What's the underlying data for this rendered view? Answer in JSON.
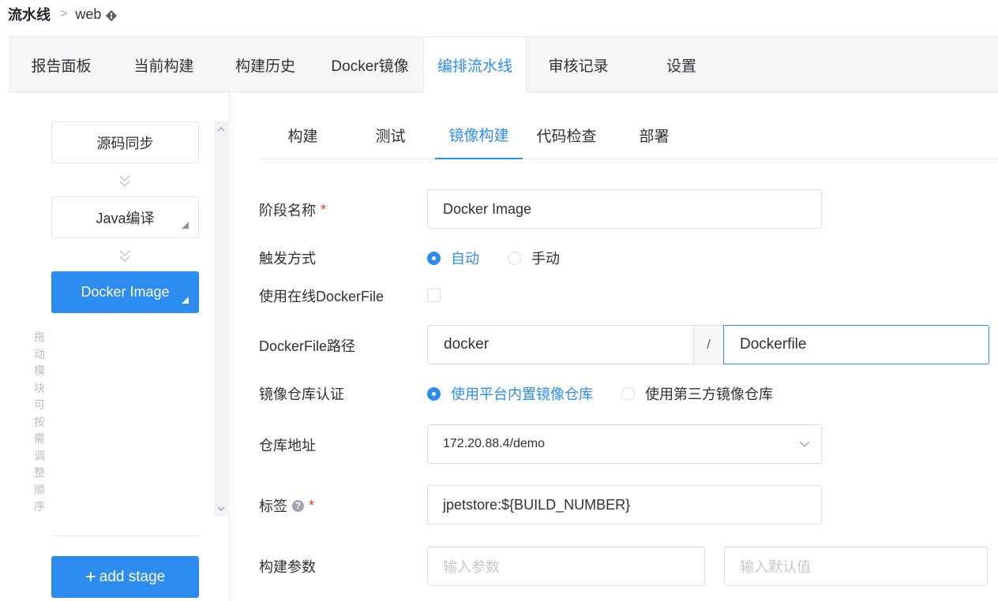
{
  "breadcrumb": {
    "root": "流水线",
    "separator": ">",
    "current": "web"
  },
  "top_tabs": [
    {
      "label": "报告面板",
      "active": false
    },
    {
      "label": "当前构建",
      "active": false
    },
    {
      "label": "构建历史",
      "active": false
    },
    {
      "label": "Docker镜像",
      "active": false
    },
    {
      "label": "编排流水线",
      "active": true
    },
    {
      "label": "审核记录",
      "active": false
    },
    {
      "label": "设置",
      "active": false
    }
  ],
  "stages": {
    "drag_hint": "拖动模块可按需调整顺序",
    "items": [
      {
        "label": "源码同步",
        "active": false
      },
      {
        "label": "Java编译",
        "active": false
      },
      {
        "label": "Docker Image",
        "active": true
      }
    ],
    "add_label": "add stage"
  },
  "sub_tabs": [
    {
      "label": "构建",
      "active": false
    },
    {
      "label": "测试",
      "active": false
    },
    {
      "label": "镜像构建",
      "active": true
    },
    {
      "label": "代码检查",
      "active": false
    },
    {
      "label": "部署",
      "active": false
    }
  ],
  "form": {
    "stage_name": {
      "label": "阶段名称",
      "value": "Docker Image",
      "required": true
    },
    "trigger": {
      "label": "触发方式",
      "options": [
        "自动",
        "手动"
      ],
      "selected": "自动"
    },
    "online_dockerfile": {
      "label": "使用在线DockerFile",
      "checked": false
    },
    "dockerfile_path": {
      "label": "DockerFile路径",
      "dir": "docker",
      "separator": "/",
      "file": "Dockerfile"
    },
    "registry_auth": {
      "label": "镜像仓库认证",
      "options": [
        "使用平台内置镜像仓库",
        "使用第三方镜像仓库"
      ],
      "selected": "使用平台内置镜像仓库"
    },
    "registry_address": {
      "label": "仓库地址",
      "value": "172.20.88.4/demo"
    },
    "tag": {
      "label": "标签",
      "help": "?",
      "value": "jpetstore:${BUILD_NUMBER}",
      "required": true
    },
    "build_args": {
      "label": "构建参数",
      "param_placeholder": "输入参数",
      "default_placeholder": "输入默认值"
    }
  },
  "colors": {
    "accent": "#2d8cf0",
    "required": "#ed4014",
    "tab_bar": "#f5f6f8"
  }
}
